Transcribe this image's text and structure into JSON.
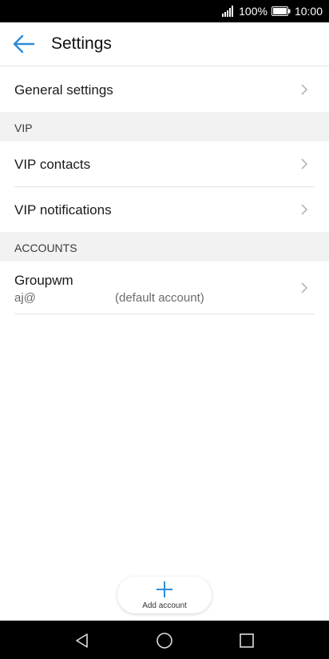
{
  "status_bar": {
    "battery": "100%",
    "time": "10:00"
  },
  "header": {
    "title": "Settings"
  },
  "general_settings": {
    "label": "General settings"
  },
  "vip": {
    "header": "VIP",
    "items": [
      {
        "label": "VIP contacts"
      },
      {
        "label": "VIP notifications"
      }
    ]
  },
  "accounts": {
    "header": "ACCOUNTS",
    "items": [
      {
        "name": "Groupwm",
        "email": "aj@",
        "note": "(default account)"
      }
    ]
  },
  "fab": {
    "label": "Add account"
  },
  "colors": {
    "accent": "#2e8bd6",
    "section_bg": "#f2f2f2"
  }
}
